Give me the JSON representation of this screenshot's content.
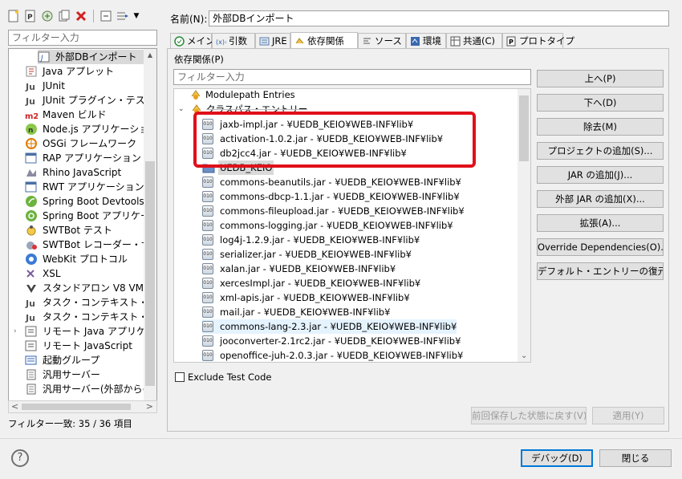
{
  "left": {
    "filter_placeholder": "フィルター入力",
    "items": [
      "外部DBインポート",
      "Java アプレット",
      "JUnit",
      "JUnit プラグイン・テスト",
      "Maven ビルド",
      "Node.js アプリケーション",
      "OSGi フレームワーク",
      "RAP アプリケーション",
      "Rhino JavaScript",
      "RWT アプリケーション",
      "Spring Boot Devtools クラ",
      "Spring Boot アプリケーショ",
      "SWTBot テスト",
      "SWTBot レコーダー・サーバー",
      "WebKit プロトコル",
      "XSL",
      "スタンドアロン V8 VM",
      "タスク・コンテキスト・テスト",
      "タスク・コンテキスト・プラグイン",
      "リモート Java アプリケーション",
      "リモート JavaScript",
      "起動グループ",
      "汎用サーバー",
      "汎用サーバー(外部からの起"
    ],
    "filter_status": "フィルター一致: 35 / 36 項目"
  },
  "name": {
    "label": "名前(N):",
    "value": "外部DBインポート"
  },
  "tabs": [
    "メイン",
    "引数",
    "JRE",
    "依存関係",
    "ソース",
    "環境",
    "共通(C)",
    "プロトタイプ"
  ],
  "deps": {
    "label": "依存関係(P)",
    "filter_placeholder": "フィルター入力",
    "modulepath": "Modulepath Entries",
    "classpath": "クラスパス・エントリー",
    "highlighted": [
      "jaxb-impl.jar - ¥UEDB_KEIO¥WEB-INF¥lib¥",
      "activation-1.0.2.jar - ¥UEDB_KEIO¥WEB-INF¥lib¥",
      "db2jcc4.jar - ¥UEDB_KEIO¥WEB-INF¥lib¥"
    ],
    "project": "UEDB_KEIO",
    "entries": [
      "commons-beanutils.jar - ¥UEDB_KEIO¥WEB-INF¥lib¥",
      "commons-dbcp-1.1.jar - ¥UEDB_KEIO¥WEB-INF¥lib¥",
      "commons-fileupload.jar - ¥UEDB_KEIO¥WEB-INF¥lib¥",
      "commons-logging.jar - ¥UEDB_KEIO¥WEB-INF¥lib¥",
      "log4j-1.2.9.jar - ¥UEDB_KEIO¥WEB-INF¥lib¥",
      "serializer.jar - ¥UEDB_KEIO¥WEB-INF¥lib¥",
      "xalan.jar - ¥UEDB_KEIO¥WEB-INF¥lib¥",
      "xercesImpl.jar - ¥UEDB_KEIO¥WEB-INF¥lib¥",
      "xml-apis.jar - ¥UEDB_KEIO¥WEB-INF¥lib¥",
      "mail.jar - ¥UEDB_KEIO¥WEB-INF¥lib¥",
      "commons-lang-2.3.jar - ¥UEDB_KEIO¥WEB-INF¥lib¥",
      "jooconverter-2.1rc2.jar - ¥UEDB_KEIO¥WEB-INF¥lib¥",
      "openoffice-juh-2.0.3.jar - ¥UEDB_KEIO¥WEB-INF¥lib¥"
    ],
    "exclude_test": "Exclude Test Code"
  },
  "side_buttons": [
    "上へ(P)",
    "下へ(D)",
    "除去(M)",
    "プロジェクトの追加(S)...",
    "JAR の追加(J)...",
    "外部 JAR の追加(X)...",
    "拡張(A)...",
    "Override Dependencies(O)...",
    "デフォルト・エントリーの復元(R)"
  ],
  "bottom": {
    "revert": "前回保存した状態に戻す(V)",
    "apply": "適用(Y)",
    "debug": "デバッグ(D)",
    "close": "閉じる",
    "help": "?"
  },
  "colors": {
    "highlight_box": "#e0101a",
    "selection": "#cce8ff"
  }
}
